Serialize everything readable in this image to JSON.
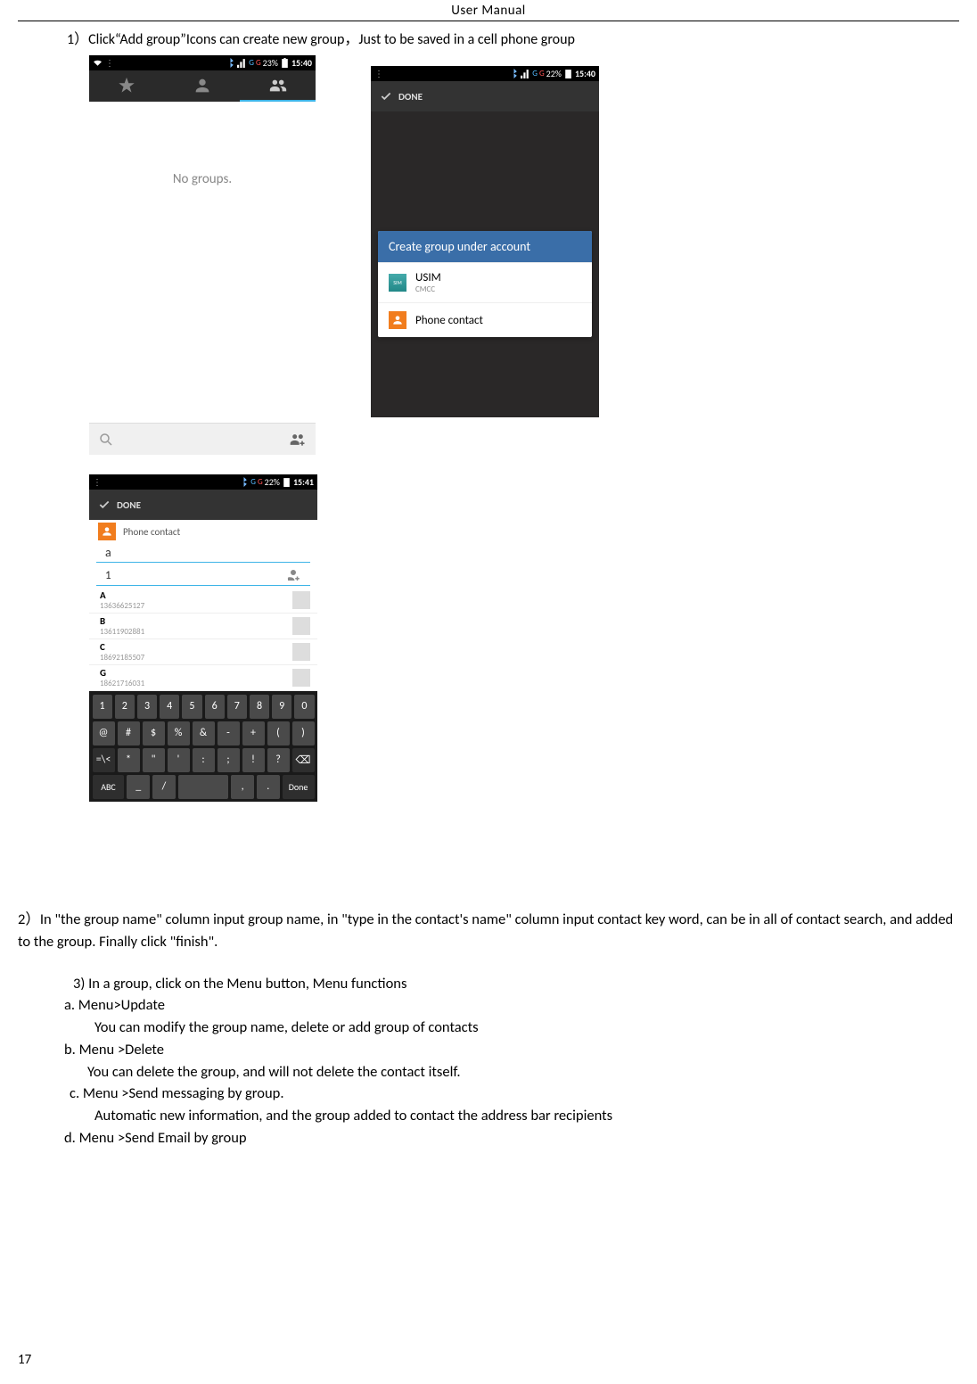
{
  "header": "User    Manual",
  "instr1": "1）Click“Add group”Icons can create new group，Just to be saved in a cell phone group",
  "phone1": {
    "battery": "23%",
    "time": "15:40",
    "nogroups": "No groups."
  },
  "phone2": {
    "battery": "22%",
    "time": "15:40",
    "done": "DONE",
    "dialog_header": "Create group under account",
    "usim": "USIM",
    "usim_sub": "CMCC",
    "phone_contact": "Phone contact"
  },
  "phone3": {
    "battery": "22%",
    "time": "15:41",
    "done": "DONE",
    "phone_contact": "Phone contact",
    "input_a": "a",
    "input_1": "1",
    "contacts": [
      {
        "letter": "A",
        "num": "13636625127"
      },
      {
        "letter": "B",
        "num": "13611902881"
      },
      {
        "letter": "C",
        "num": "18692185507"
      },
      {
        "letter": "G",
        "num": "18621716031"
      }
    ],
    "keyboard": {
      "row1": [
        "1",
        "2",
        "3",
        "4",
        "5",
        "6",
        "7",
        "8",
        "9",
        "0"
      ],
      "row2": [
        "@",
        "#",
        "$",
        "%",
        "&",
        "-",
        "+",
        "(",
        ")"
      ],
      "row3": [
        "=\\<",
        "*",
        "\"",
        "'",
        ":",
        ";",
        "!",
        "?",
        "⌫"
      ],
      "row4": [
        "ABC",
        "_",
        "/",
        "",
        ",",
        ".",
        "Done"
      ]
    }
  },
  "step2": "2）In \"the group name\" column input group name, in \"type in the contact's name\" column input contact key word, can be in all of contact search, and added to the group. Finally click \"finish\".",
  "step3_title": "3) In a group, click on the Menu button,    Menu functions",
  "item_a": "a.    Menu>Update",
  "item_a_desc": "You can modify the group name, delete or add group of contacts",
  "item_b": "b.    Menu >Delete",
  "item_b_desc": "You can delete the group, and will not delete the contact itself.",
  "item_c": "c.    Menu >Send messaging by group.",
  "item_c_desc": "Automatic new information, and the group added to contact the address bar recipients",
  "item_d": "d.    Menu >Send Email by group",
  "page_number": "17"
}
